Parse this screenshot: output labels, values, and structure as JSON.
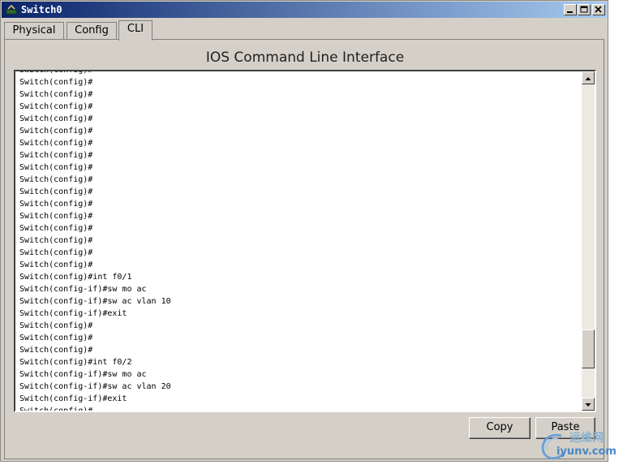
{
  "window": {
    "title": "Switch0"
  },
  "tabs": [
    {
      "label": "Physical"
    },
    {
      "label": "Config"
    },
    {
      "label": "CLI"
    }
  ],
  "cli": {
    "heading": "IOS Command Line Interface",
    "lines": [
      "Switch(config)#",
      "Switch(config)#",
      "Switch(config)#",
      "Switch(config)#",
      "Switch(config)#",
      "Switch(config)#",
      "Switch(config)#",
      "Switch(config)#",
      "Switch(config)#",
      "Switch(config)#",
      "Switch(config)#",
      "Switch(config)#",
      "Switch(config)#",
      "Switch(config)#",
      "Switch(config)#",
      "Switch(config)#",
      "Switch(config)#",
      "Switch(config)#int f0/1",
      "Switch(config-if)#sw mo ac",
      "Switch(config-if)#sw ac vlan 10",
      "Switch(config-if)#exit",
      "Switch(config)#",
      "Switch(config)#",
      "Switch(config)#",
      "Switch(config)#int f0/2",
      "Switch(config-if)#sw mo ac",
      "Switch(config-if)#sw ac vlan 20",
      "Switch(config-if)#exit",
      "Switch(config)#"
    ]
  },
  "buttons": {
    "copy": "Copy",
    "paste": "Paste"
  },
  "watermark": {
    "top": "运维网",
    "bottom": "iyunv.com"
  }
}
